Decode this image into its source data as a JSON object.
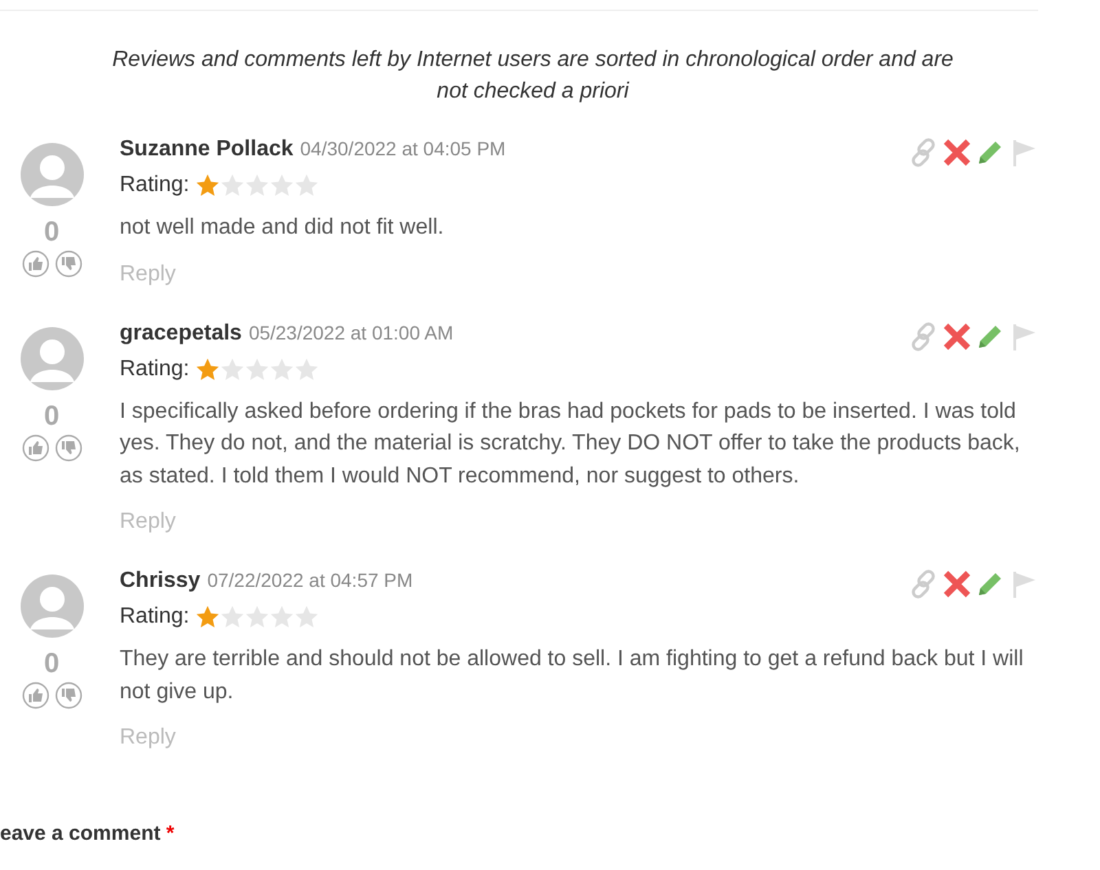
{
  "notice": "Reviews and comments left by Internet users are sorted in chronological order and are not checked a priori",
  "comments": [
    {
      "author": "Suzanne Pollack",
      "date": "04/30/2022 at 04:05 PM",
      "rating_label": "Rating:",
      "stars": 1,
      "text": "not well made and did not fit well.",
      "votes": "0",
      "reply": "Reply"
    },
    {
      "author": "gracepetals",
      "date": "05/23/2022 at 01:00 AM",
      "rating_label": "Rating:",
      "stars": 1,
      "text": "I specifically asked before ordering if the bras had pockets for pads to be inserted. I was told yes. They do not, and the material is scratchy. They DO NOT offer to take the products back, as stated. I told them I would NOT recommend, nor suggest to others.",
      "votes": "0",
      "reply": "Reply"
    },
    {
      "author": "Chrissy",
      "date": "07/22/2022 at 04:57 PM",
      "rating_label": "Rating:",
      "stars": 1,
      "text": "They are terrible and should not be allowed to sell. I am fighting to get a refund back but I will not give up.",
      "votes": "0",
      "reply": "Reply"
    }
  ],
  "leave_comment": {
    "title": "eave a comment",
    "required_mark": "*"
  }
}
